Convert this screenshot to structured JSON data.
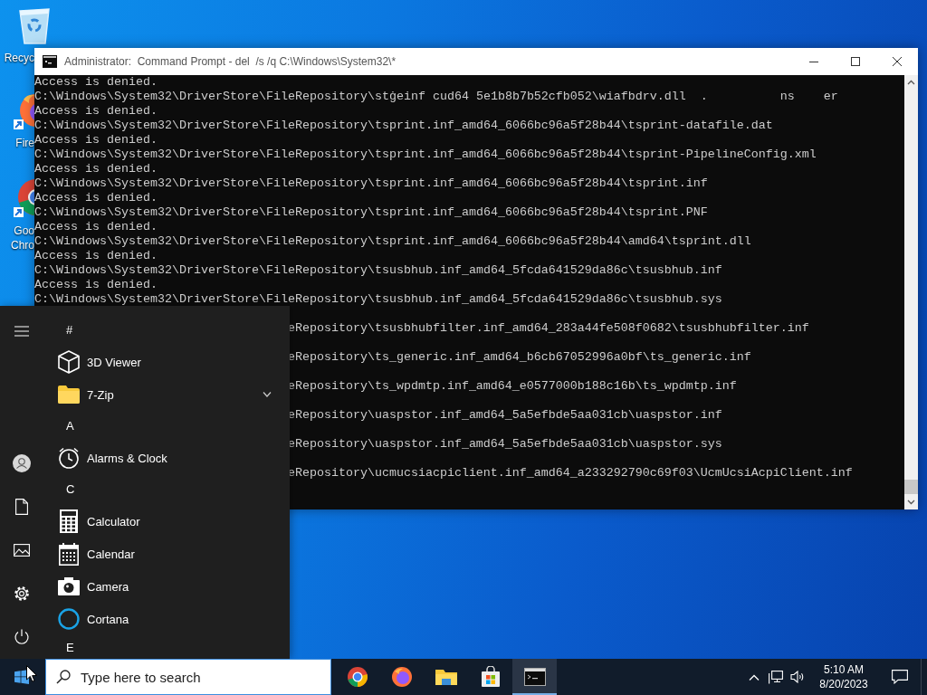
{
  "desktop_icons": [
    {
      "kind": "recycle-bin",
      "label_lines": [
        "Recyc"
      ]
    },
    {
      "kind": "firefox",
      "label_lines": [
        "Fire"
      ]
    },
    {
      "kind": "chrome",
      "label_lines": [
        "Goo",
        "Chro"
      ]
    }
  ],
  "console": {
    "title": "Administrator:  Command Prompt - del  /s /q C:\\Windows\\System32\\*",
    "lines": [
      {
        "kind": "full",
        "text": "Access is denied."
      },
      {
        "kind": "full",
        "text": "C:\\Windows\\System32\\DriverStore\\FileRepository\\stġeinf cud64 5e1b8b7b52cfb052\\wiafbdrv.dll  .          ns    er"
      },
      {
        "kind": "full",
        "text": "Access is denied."
      },
      {
        "kind": "full",
        "text": "C:\\Windows\\System32\\DriverStore\\FileRepository\\tsprint.inf_amd64_6066bc96a5f28b44\\tsprint-datafile.dat"
      },
      {
        "kind": "full",
        "text": "Access is denied."
      },
      {
        "kind": "full",
        "text": "C:\\Windows\\System32\\DriverStore\\FileRepository\\tsprint.inf_amd64_6066bc96a5f28b44\\tsprint-PipelineConfig.xml"
      },
      {
        "kind": "full",
        "text": "Access is denied."
      },
      {
        "kind": "full",
        "text": "C:\\Windows\\System32\\DriverStore\\FileRepository\\tsprint.inf_amd64_6066bc96a5f28b44\\tsprint.inf"
      },
      {
        "kind": "full",
        "text": "Access is denied."
      },
      {
        "kind": "full",
        "text": "C:\\Windows\\System32\\DriverStore\\FileRepository\\tsprint.inf_amd64_6066bc96a5f28b44\\tsprint.PNF"
      },
      {
        "kind": "full",
        "text": "Access is denied."
      },
      {
        "kind": "full",
        "text": "C:\\Windows\\System32\\DriverStore\\FileRepository\\tsprint.inf_amd64_6066bc96a5f28b44\\amd64\\tsprint.dll"
      },
      {
        "kind": "full",
        "text": "Access is denied."
      },
      {
        "kind": "full",
        "text": "C:\\Windows\\System32\\DriverStore\\FileRepository\\tsusbhub.inf_amd64_5fcda641529da86c\\tsusbhub.inf"
      },
      {
        "kind": "full",
        "text": "Access is denied."
      },
      {
        "kind": "full",
        "text": "C:\\Windows\\System32\\DriverStore\\FileRepository\\tsusbhub.inf_amd64_5fcda641529da86c\\tsusbhub.sys"
      },
      {
        "kind": "cut",
        "text": "eRepository\\tsusbhubfilter.inf_amd64_283a44fe508f0682\\tsusbhubfilter.inf"
      },
      {
        "kind": "cut",
        "text": "eRepository\\ts_generic.inf_amd64_b6cb67052996a0bf\\ts_generic.inf"
      },
      {
        "kind": "cut",
        "text": "eRepository\\ts_wpdmtp.inf_amd64_e0577000b188c16b\\ts_wpdmtp.inf"
      },
      {
        "kind": "cut",
        "text": "eRepository\\uaspstor.inf_amd64_5a5efbde5aa031cb\\uaspstor.inf"
      },
      {
        "kind": "cut",
        "text": "eRepository\\uaspstor.inf_amd64_5a5efbde5aa031cb\\uaspstor.sys"
      },
      {
        "kind": "cut",
        "text": "eRepository\\ucmucsiacpiclient.inf_amd64_a233292790c69f03\\UcmUcsiAcpiClient.inf"
      }
    ]
  },
  "start_menu": {
    "rail": [
      {
        "kind": "menu"
      },
      {
        "kind": "user"
      },
      {
        "kind": "documents"
      },
      {
        "kind": "pictures"
      },
      {
        "kind": "settings"
      },
      {
        "kind": "power"
      }
    ],
    "apps": [
      {
        "kind": "header",
        "label": "#"
      },
      {
        "kind": "app",
        "label": "3D Viewer"
      },
      {
        "kind": "folder",
        "label": "7-Zip",
        "expanded": false
      },
      {
        "kind": "header",
        "label": "A"
      },
      {
        "kind": "app",
        "label": "Alarms & Clock"
      },
      {
        "kind": "header",
        "label": "C"
      },
      {
        "kind": "app",
        "label": "Calculator"
      },
      {
        "kind": "app",
        "label": "Calendar"
      },
      {
        "kind": "app",
        "label": "Camera"
      },
      {
        "kind": "app",
        "label": "Cortana"
      },
      {
        "kind": "header",
        "label": "E"
      }
    ]
  },
  "taskbar": {
    "search": {
      "placeholder": "Type here to search"
    },
    "pinned": [
      {
        "kind": "chrome",
        "active": false
      },
      {
        "kind": "firefox",
        "active": false
      },
      {
        "kind": "explorer",
        "active": false
      },
      {
        "kind": "store",
        "active": false
      },
      {
        "kind": "terminal",
        "active": true
      }
    ],
    "clock": {
      "time": "5:10 AM",
      "date": "8/20/2023"
    }
  }
}
